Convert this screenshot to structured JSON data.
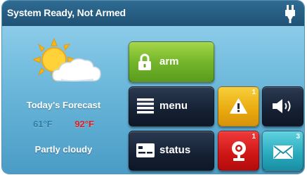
{
  "header": {
    "status_text": "System Ready, Not Armed",
    "power_icon": "ac-power-plug-icon"
  },
  "weather": {
    "icon": "partly-cloudy-icon",
    "forecast_label": "Today's Forecast",
    "low_temp": "61°F",
    "high_temp": "92°F",
    "condition": "Partly cloudy",
    "colors": {
      "low": "#2d7ea6",
      "high": "#e02020"
    }
  },
  "buttons": {
    "arm": {
      "label": "arm",
      "icon": "padlock-icon",
      "color": "#74b62b"
    },
    "menu": {
      "label": "menu",
      "icon": "menu-list-icon"
    },
    "status": {
      "label": "status",
      "icon": "status-card-icon"
    },
    "alert": {
      "icon": "warning-triangle-icon",
      "badge": "1",
      "color": "#e9a90f"
    },
    "sound": {
      "icon": "speaker-icon"
    },
    "alarm": {
      "icon": "alarm-bell-icon",
      "badge": "1",
      "color": "#cf1515"
    },
    "messages": {
      "icon": "envelope-icon",
      "badge": "3",
      "color": "#29a9bd"
    }
  }
}
